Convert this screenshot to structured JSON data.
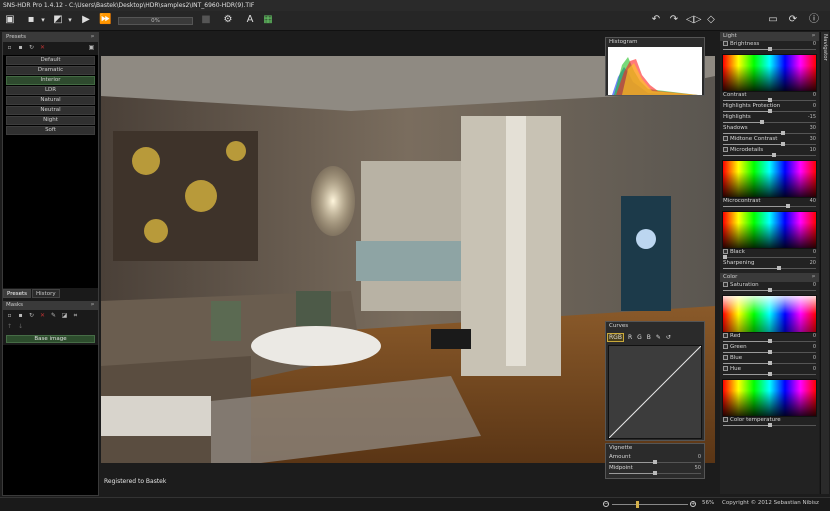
{
  "window": {
    "title": "SNS-HDR Pro 1.4.12 - C:\\Users\\Bastek\\Desktop\\HDR\\samples2\\INT_6960-HDR(9).TIF"
  },
  "toolbar": {
    "progress_label": "0%"
  },
  "presets": {
    "header": "Presets",
    "pin": "ᵖ",
    "items": [
      "Default",
      "Dramatic",
      "Interior",
      "LDR",
      "Natural",
      "Neutral",
      "Night",
      "Soft"
    ],
    "selected_index": 2
  },
  "left_tabs": {
    "presets": "Presets",
    "history": "History"
  },
  "masks": {
    "header": "Masks",
    "base": "Base image"
  },
  "photo": {
    "registered_text": "Registered to Bastek"
  },
  "histogram": {
    "title": "Histogram"
  },
  "curves": {
    "title": "Curves",
    "channels": [
      "RGB",
      "R",
      "G",
      "B"
    ]
  },
  "vignette": {
    "title": "Vignette",
    "sliders": [
      {
        "label": "Amount",
        "value": "0",
        "level": 0.5
      },
      {
        "label": "Midpoint",
        "value": "50",
        "level": 0.5
      }
    ]
  },
  "navigator": {
    "label": "Navigator"
  },
  "light": {
    "header": "Light",
    "sliders": [
      {
        "label": "Brightness",
        "value": "0",
        "level": 0.5,
        "check": true
      },
      {
        "label": "Contrast",
        "value": "0",
        "level": 0.5,
        "check": false
      },
      {
        "label": "Highlights Protection",
        "value": "0",
        "level": 0.5,
        "check": false
      },
      {
        "label": "Highlights",
        "value": "-15",
        "level": 0.42,
        "check": false
      },
      {
        "label": "Shadows",
        "value": "30",
        "level": 0.65,
        "check": false
      },
      {
        "label": "Midtone Contrast",
        "value": "30",
        "level": 0.65,
        "check": true
      },
      {
        "label": "Microdetails",
        "value": "10",
        "level": 0.55,
        "check": true
      },
      {
        "label": "Microcontrast",
        "value": "40",
        "level": 0.7,
        "check": false
      },
      {
        "label": "Black",
        "value": "0",
        "level": 0.02,
        "check": true
      },
      {
        "label": "Sharpening",
        "value": "20",
        "level": 0.6,
        "check": false
      }
    ]
  },
  "color": {
    "header": "Color",
    "sliders": [
      {
        "label": "Saturation",
        "value": "0",
        "level": 0.5,
        "check": true
      },
      {
        "label": "Red",
        "value": "0",
        "level": 0.5,
        "check": true
      },
      {
        "label": "Green",
        "value": "0",
        "level": 0.5,
        "check": true
      },
      {
        "label": "Blue",
        "value": "0",
        "level": 0.5,
        "check": true
      },
      {
        "label": "Hue",
        "value": "0",
        "level": 0.5,
        "check": true
      },
      {
        "label": "Color temperature",
        "value": "",
        "level": 0.5,
        "check": true
      }
    ]
  },
  "statusbar": {
    "zoom": "56%",
    "copyright": "Copyright © 2012 Sebastian Nibisz"
  },
  "colors": {
    "accent_green": "#2e4a2e",
    "panel": "#222222"
  }
}
